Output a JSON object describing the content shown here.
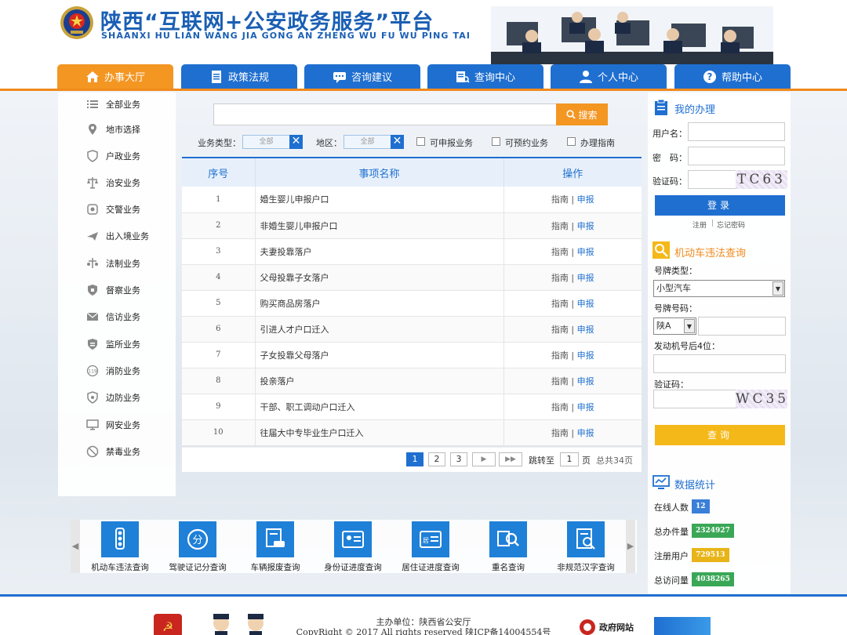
{
  "header": {
    "title": "陕西“互联网+公安政务服务”平台",
    "subtitle": "SHAANXI HU LIAN WANG JIA GONG AN ZHENG WU FU WU PING TAI"
  },
  "nav": [
    {
      "label": "办事大厅",
      "icon": "home-icon"
    },
    {
      "label": "政策法规",
      "icon": "document-icon"
    },
    {
      "label": "咨询建议",
      "icon": "chat-icon"
    },
    {
      "label": "查询中心",
      "icon": "search-list-icon"
    },
    {
      "label": "个人中心",
      "icon": "user-icon"
    },
    {
      "label": "帮助中心",
      "icon": "help-icon"
    }
  ],
  "sidebar": [
    {
      "label": "全部业务",
      "icon": "list-icon"
    },
    {
      "label": "地市选择",
      "icon": "location-icon"
    },
    {
      "label": "户政业务",
      "icon": "shield-icon"
    },
    {
      "label": "治安业务",
      "icon": "scale-icon"
    },
    {
      "label": "交警业务",
      "icon": "traffic-icon"
    },
    {
      "label": "出入境业务",
      "icon": "plane-icon"
    },
    {
      "label": "法制业务",
      "icon": "law-icon"
    },
    {
      "label": "督察业务",
      "icon": "inspect-icon"
    },
    {
      "label": "信访业务",
      "icon": "mail-icon"
    },
    {
      "label": "监所业务",
      "icon": "building-icon"
    },
    {
      "label": "消防业务",
      "icon": "fire-icon"
    },
    {
      "label": "边防业务",
      "icon": "border-icon"
    },
    {
      "label": "网安业务",
      "icon": "monitor-icon"
    },
    {
      "label": "禁毒业务",
      "icon": "ban-icon"
    }
  ],
  "search": {
    "value": "",
    "button": "搜索"
  },
  "filters": {
    "type_label": "业务类型：",
    "type_value": "全部",
    "region_label": "地区：",
    "region_value": "全部",
    "checks": [
      "可申报业务",
      "可预约业务",
      "办理指南"
    ]
  },
  "table": {
    "headers": [
      "序号",
      "事项名称",
      "操作"
    ],
    "guide": "指南",
    "sep": "|",
    "apply": "申报",
    "rows": [
      {
        "no": "1",
        "name": "婚生婴儿申报户口"
      },
      {
        "no": "2",
        "name": "非婚生婴儿申报户口"
      },
      {
        "no": "3",
        "name": "夫妻投靠落户"
      },
      {
        "no": "4",
        "name": "父母投靠子女落户"
      },
      {
        "no": "5",
        "name": "购买商品房落户"
      },
      {
        "no": "6",
        "name": "引进人才户口迁入"
      },
      {
        "no": "7",
        "name": "子女投靠父母落户"
      },
      {
        "no": "8",
        "name": "投亲落户"
      },
      {
        "no": "9",
        "name": "干部、职工调动户口迁入"
      },
      {
        "no": "10",
        "name": "往届大中专毕业生户口迁入"
      }
    ]
  },
  "pager": {
    "pages": [
      "1",
      "2",
      "3"
    ],
    "next": "▶",
    "last": "▶▶",
    "jump_label": "跳转至",
    "jump_value": "1",
    "page_unit": "页",
    "total": "总共34页"
  },
  "login": {
    "title": "我的办理",
    "username_label": "用户名：",
    "password_label": "密　码：",
    "captcha_label": "验证码：",
    "captcha": "TC63",
    "login_button": "登录",
    "register": "注册",
    "sep": "|",
    "forgot": "忘记密码"
  },
  "violation": {
    "title": "机动车违法查询",
    "plate_type_label": "号牌类型：",
    "plate_type_value": "小型汽车",
    "plate_no_label": "号牌号码：",
    "plate_prefix": "陕A",
    "engine_label": "发动机号后4位：",
    "captcha_label": "验证码：",
    "captcha": "WC35",
    "query_button": "查询"
  },
  "stats": {
    "title": "数据统计",
    "items": [
      {
        "label": "在线人数",
        "value": "12",
        "color": "#3b7fd9"
      },
      {
        "label": "总办件量",
        "value": "2324927",
        "color": "#3aa757"
      },
      {
        "label": "注册用户",
        "value": "729513",
        "color": "#e8b418"
      },
      {
        "label": "总访问量",
        "value": "4038265",
        "color": "#3aa757"
      }
    ]
  },
  "quick": [
    {
      "label": "机动车违法查询",
      "icon": "traffic-light-icon"
    },
    {
      "label": "驾驶证记分查询",
      "icon": "score-icon"
    },
    {
      "label": "车辆报废查询",
      "icon": "car-scrap-icon"
    },
    {
      "label": "身份证进度查询",
      "icon": "id-card-icon"
    },
    {
      "label": "居住证进度查询",
      "icon": "residence-card-icon"
    },
    {
      "label": "重名查询",
      "icon": "name-search-icon"
    },
    {
      "label": "非规范汉字查询",
      "icon": "char-search-icon"
    }
  ],
  "footer": {
    "host": "主办单位：陕西省公安厅",
    "copyright": "CopyRight © 2017 All rights reserved 陕ICP备14004554号",
    "gov_site": "政府网站"
  },
  "colors": {
    "primary": "#1f6fd0",
    "accent": "#f39622",
    "yellow": "#f5b819"
  }
}
